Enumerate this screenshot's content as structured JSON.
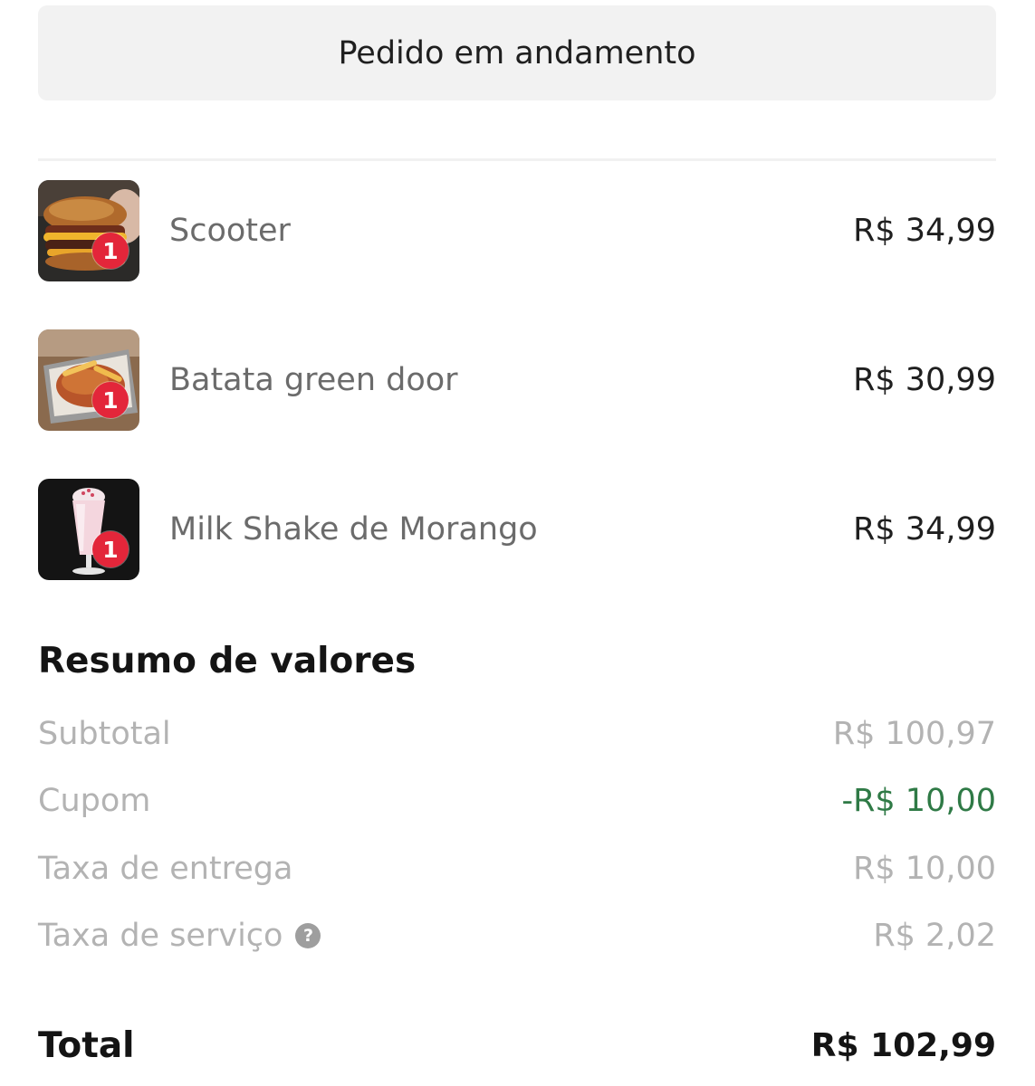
{
  "header": {
    "status_label": "Pedido em andamento"
  },
  "items": [
    {
      "name": "Scooter",
      "price": "R$ 34,99",
      "quantity": "1",
      "image_icon": "burger-photo"
    },
    {
      "name": "Batata green door",
      "price": "R$ 30,99",
      "quantity": "1",
      "image_icon": "fries-photo"
    },
    {
      "name": "Milk Shake de Morango",
      "price": "R$ 34,99",
      "quantity": "1",
      "image_icon": "milkshake-photo"
    }
  ],
  "summary": {
    "title": "Resumo de valores",
    "subtotal_label": "Subtotal",
    "subtotal_value": "R$ 100,97",
    "coupon_label": "Cupom",
    "coupon_value": "-R$ 10,00",
    "delivery_label": "Taxa de entrega",
    "delivery_value": "R$ 10,00",
    "service_label": "Taxa de serviço",
    "service_help_icon": "?",
    "service_value": "R$ 2,02",
    "total_label": "Total",
    "total_value": "R$ 102,99"
  },
  "colors": {
    "badge": "#e3263a",
    "discount": "#2f7a46",
    "muted_text": "#b3b3b3",
    "banner_bg": "#f2f2f2"
  }
}
